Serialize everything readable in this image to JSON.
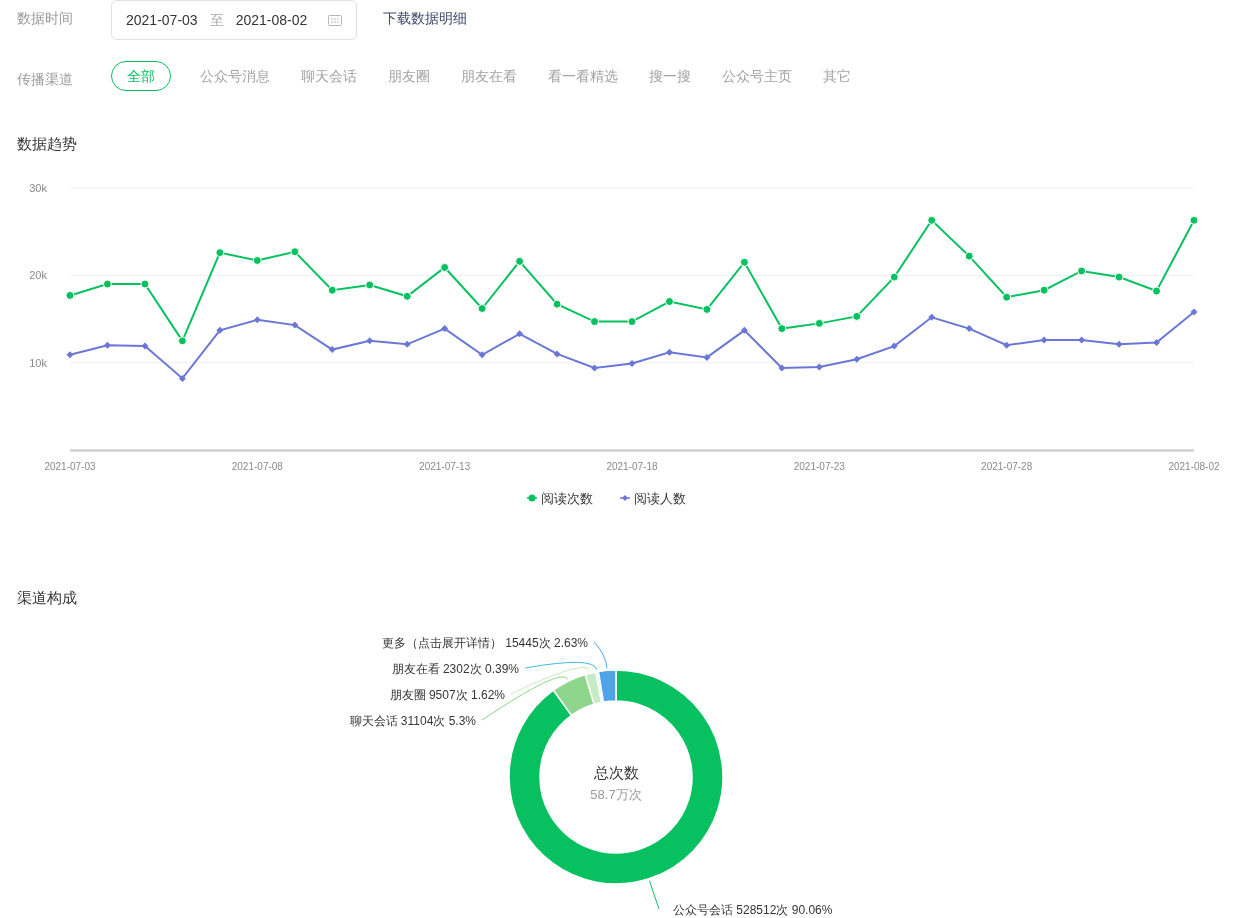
{
  "filters": {
    "date_label": "数据时间",
    "date_range": {
      "start": "2021-07-03",
      "separator": "至",
      "end": "2021-08-02"
    },
    "download_link": "下载数据明细",
    "channel_label": "传播渠道",
    "channel_tabs": [
      {
        "label": "全部",
        "selected": true
      },
      {
        "label": "公众号消息",
        "selected": false
      },
      {
        "label": "聊天会话",
        "selected": false
      },
      {
        "label": "朋友圈",
        "selected": false
      },
      {
        "label": "朋友在看",
        "selected": false
      },
      {
        "label": "看一看精选",
        "selected": false
      },
      {
        "label": "搜一搜",
        "selected": false
      },
      {
        "label": "公众号主页",
        "selected": false
      },
      {
        "label": "其它",
        "selected": false
      }
    ]
  },
  "trend": {
    "title": "数据趋势",
    "chart_data": {
      "type": "line",
      "x": [
        "2021-07-03",
        "2021-07-04",
        "2021-07-05",
        "2021-07-06",
        "2021-07-07",
        "2021-07-08",
        "2021-07-09",
        "2021-07-10",
        "2021-07-11",
        "2021-07-12",
        "2021-07-13",
        "2021-07-14",
        "2021-07-15",
        "2021-07-16",
        "2021-07-17",
        "2021-07-18",
        "2021-07-19",
        "2021-07-20",
        "2021-07-21",
        "2021-07-22",
        "2021-07-23",
        "2021-07-24",
        "2021-07-25",
        "2021-07-26",
        "2021-07-27",
        "2021-07-28",
        "2021-07-29",
        "2021-07-30",
        "2021-07-31",
        "2021-08-01",
        "2021-08-02"
      ],
      "xticks": [
        "2021-07-03",
        "2021-07-08",
        "2021-07-13",
        "2021-07-18",
        "2021-07-23",
        "2021-07-28",
        "2021-08-02"
      ],
      "yticks": [
        {
          "value": 10000,
          "label": "10k"
        },
        {
          "value": 20000,
          "label": "20k"
        },
        {
          "value": 30000,
          "label": "30k"
        }
      ],
      "ylim": [
        0,
        30000
      ],
      "xlim": [
        "2021-07-03",
        "2021-08-02"
      ],
      "legend": true,
      "series": [
        {
          "name": "阅读次数",
          "color": "#07c160",
          "marker": "circle",
          "values": [
            17700,
            19000,
            19000,
            12500,
            22600,
            21700,
            22700,
            18300,
            18900,
            17600,
            20900,
            16200,
            21600,
            16700,
            14700,
            14700,
            17000,
            16100,
            21500,
            13900,
            14500,
            15300,
            19800,
            26300,
            22200,
            17500,
            18300,
            20500,
            19800,
            18200,
            26300
          ]
        },
        {
          "name": "阅读人数",
          "color": "#6b77d6",
          "marker": "diamond",
          "values": [
            10900,
            12000,
            11900,
            8200,
            13700,
            14900,
            14300,
            11500,
            12500,
            12100,
            13900,
            10900,
            13300,
            11000,
            9400,
            9900,
            11200,
            10600,
            13700,
            9400,
            9500,
            10400,
            11900,
            15200,
            13900,
            12000,
            12600,
            12600,
            12100,
            12300,
            15800
          ]
        }
      ]
    }
  },
  "composition": {
    "title": "渠道构成",
    "center_title": "总次数",
    "center_value": "58.7万次",
    "chart_data": {
      "type": "donut",
      "categories": [
        "公众号会话",
        "聊天会话",
        "朋友圈",
        "朋友在看",
        "更多（点击展开详情）"
      ],
      "values": [
        528512,
        31104,
        9507,
        2302,
        15445
      ],
      "value_labels": [
        "528512次 90.06%",
        "31104次 5.3%",
        "9507次 1.62%",
        "2302次 0.39%",
        "15445次 2.63%"
      ],
      "colors": [
        "#07c160",
        "#8fd68d",
        "#c6ecc5",
        "#e1f4e0",
        "#4fa3e8"
      ]
    }
  }
}
